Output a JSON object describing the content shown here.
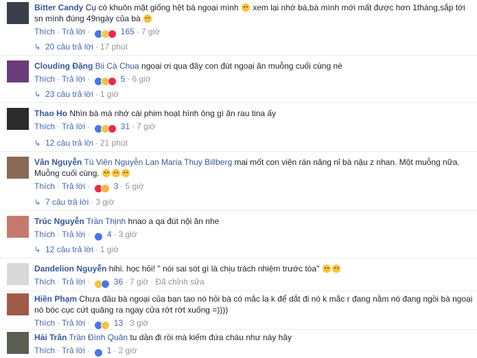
{
  "comments": [
    {
      "author": "Bitter Candy",
      "mentions": "",
      "text": "Cụ có khuôn mặt giống hệt bà ngoại mình",
      "text2": " xem lại nhớ bà,bà mình mới mất được hơn 1tháng,sắp tới sn mình đúng 49ngày của bà",
      "like": "Thích",
      "reply": "Trả lời",
      "count": "165",
      "time": "7 giờ",
      "replies_label": "20 câu trả lời",
      "replies_time": "17 phút",
      "avatar_color": "#3a3f4b"
    },
    {
      "author": "Clouding Đặng",
      "mentions": "Bii Cà Chua",
      "text": "ngoại ơi qua đây con đút ngoại ăn muỗng cuối cùng nè",
      "text2": "",
      "like": "Thích",
      "reply": "Trả lời",
      "count": "5",
      "time": "6 giờ",
      "replies_label": "23 câu trả lời",
      "replies_time": "1 giờ",
      "avatar_color": "#6a3c7a"
    },
    {
      "author": "Thao Ho",
      "mentions": "",
      "text": "Nhìn bà mà nhớ cái phim hoạt hình ông gì ăn rau tina ấy",
      "text2": "",
      "like": "Thích",
      "reply": "Trả lời",
      "count": "31",
      "time": "7 giờ",
      "replies_label": "12 câu trả lời",
      "replies_time": "21 phút",
      "avatar_color": "#2b2b2b"
    },
    {
      "author": "Vân Nguyễn",
      "mentions": "Tú Viên Nguyễn Lan Maria Thuy Billberg",
      "text": "mai mốt con viên rán năng nỉ bà nậu z nhan. Một muỗng nữa. Muỗng cuối cùng.",
      "text2": "",
      "like": "Thích",
      "reply": "Trả lời",
      "count": "3",
      "time": "5 giờ",
      "replies_label": "7 câu trả lời",
      "replies_time": "3 giờ",
      "avatar_color": "#8a6a55"
    },
    {
      "author": "Trúc Nguyễn",
      "mentions": "Trần Thịnh",
      "text": "hnao a qa đút nội ăn nhe",
      "text2": "",
      "like": "Thích",
      "reply": "Trả lời",
      "count": "4",
      "time": "3 giờ",
      "replies_label": "12 câu trả lời",
      "replies_time": "1 giờ",
      "avatar_color": "#c47b6e"
    },
    {
      "author": "Dandelion Nguyễn",
      "mentions": "",
      "text": "hihi. học hỏi! \" nói sai sót gì là chịu trách nhiệm trước tòa\"",
      "text2": "",
      "like": "Thích",
      "reply": "Trả lời",
      "count": "36",
      "time": "7 giờ",
      "edited": "Đã chỉnh sửa",
      "replies_label": "",
      "replies_time": "",
      "avatar_color": "#d9d9d9"
    },
    {
      "author": "Hiền Phạm",
      "mentions": "",
      "text": "Chưa đâu bà ngoại của bạn tao nó hỏi bà có mắc ỉa k để dắt đi nó k mắc r đang nằm nó đang ngồi bà ngoại nó bóc cục cứt quăng ra ngay cửa rớt rớt xuống =))))",
      "text2": "",
      "like": "Thích",
      "reply": "Trả lời",
      "count": "13",
      "time": "3 giờ",
      "replies_label": "",
      "replies_time": "",
      "avatar_color": "#a05a48"
    },
    {
      "author": "Hải Trần",
      "mentions": "Trần Đình Quân",
      "text": "tu dần đi rồi mà kiếm đứa cháu như này hây",
      "text2": "",
      "like": "Thích",
      "reply": "Trả lời",
      "count": "1",
      "time": "2 giờ",
      "replies_label": "",
      "replies_time": "",
      "avatar_color": "#5b5f52"
    }
  ]
}
